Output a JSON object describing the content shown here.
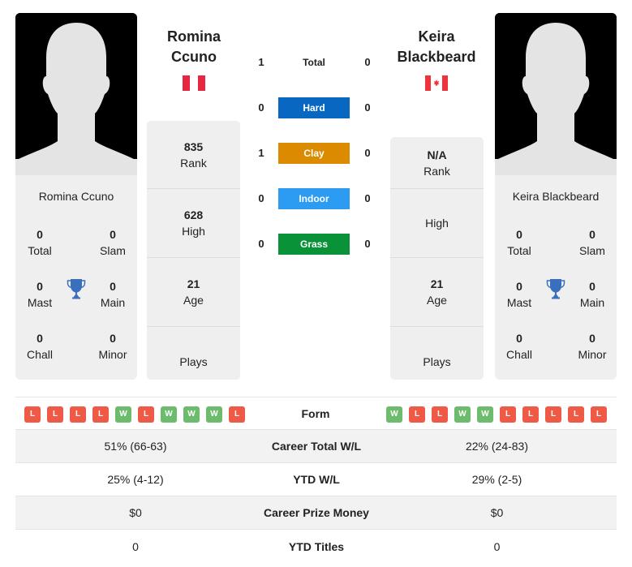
{
  "players": {
    "left": {
      "name": "Romina Ccuno",
      "name_line1": "Romina",
      "name_line2": "Ccuno",
      "country_flag": "peru-flag",
      "flag_colors": {
        "primary": "#e8263f",
        "secondary": "#ffffff"
      },
      "titles": {
        "total": {
          "value": "0",
          "label": "Total"
        },
        "slam": {
          "value": "0",
          "label": "Slam"
        },
        "mast": {
          "value": "0",
          "label": "Mast"
        },
        "main": {
          "value": "0",
          "label": "Main"
        },
        "chall": {
          "value": "0",
          "label": "Chall"
        },
        "minor": {
          "value": "0",
          "label": "Minor"
        }
      },
      "info": {
        "rank": {
          "value": "835",
          "label": "Rank"
        },
        "high": {
          "value": "628",
          "label": "High"
        },
        "age": {
          "value": "21",
          "label": "Age"
        },
        "plays": {
          "value": "",
          "label": "Plays"
        }
      },
      "form": [
        "L",
        "L",
        "L",
        "L",
        "W",
        "L",
        "W",
        "W",
        "W",
        "L"
      ]
    },
    "right": {
      "name": "Keira Blackbeard",
      "name_line1": "Keira",
      "name_line2": "Blackbeard",
      "country_flag": "canada-flag",
      "flag_colors": {
        "primary": "#f0323a",
        "secondary": "#ffffff"
      },
      "titles": {
        "total": {
          "value": "0",
          "label": "Total"
        },
        "slam": {
          "value": "0",
          "label": "Slam"
        },
        "mast": {
          "value": "0",
          "label": "Mast"
        },
        "main": {
          "value": "0",
          "label": "Main"
        },
        "chall": {
          "value": "0",
          "label": "Chall"
        },
        "minor": {
          "value": "0",
          "label": "Minor"
        }
      },
      "info": {
        "rank": {
          "value": "N/A",
          "label": "Rank"
        },
        "high": {
          "value": "",
          "label": "High"
        },
        "age": {
          "value": "21",
          "label": "Age"
        },
        "plays": {
          "value": "",
          "label": "Plays"
        }
      },
      "form": [
        "W",
        "L",
        "L",
        "W",
        "W",
        "L",
        "L",
        "L",
        "L",
        "L"
      ]
    }
  },
  "head_to_head": [
    {
      "label": "Total",
      "left": "1",
      "right": "0",
      "color": ""
    },
    {
      "label": "Hard",
      "left": "0",
      "right": "0",
      "color": "#0868c1"
    },
    {
      "label": "Clay",
      "left": "1",
      "right": "0",
      "color": "#dc8b00"
    },
    {
      "label": "Indoor",
      "left": "0",
      "right": "0",
      "color": "#2b9cf2"
    },
    {
      "label": "Grass",
      "left": "0",
      "right": "0",
      "color": "#0a9239"
    }
  ],
  "form_label": "Form",
  "form_colors": {
    "W": "#6dbb6d",
    "L": "#ee5a45"
  },
  "trophy_color": "#3a6fbd",
  "stats": [
    {
      "label": "Career Total W/L",
      "left": "51% (66-63)",
      "right": "22% (24-83)"
    },
    {
      "label": "YTD W/L",
      "left": "25% (4-12)",
      "right": "29% (2-5)"
    },
    {
      "label": "Career Prize Money",
      "left": "$0",
      "right": "$0"
    },
    {
      "label": "YTD Titles",
      "left": "0",
      "right": "0"
    }
  ]
}
